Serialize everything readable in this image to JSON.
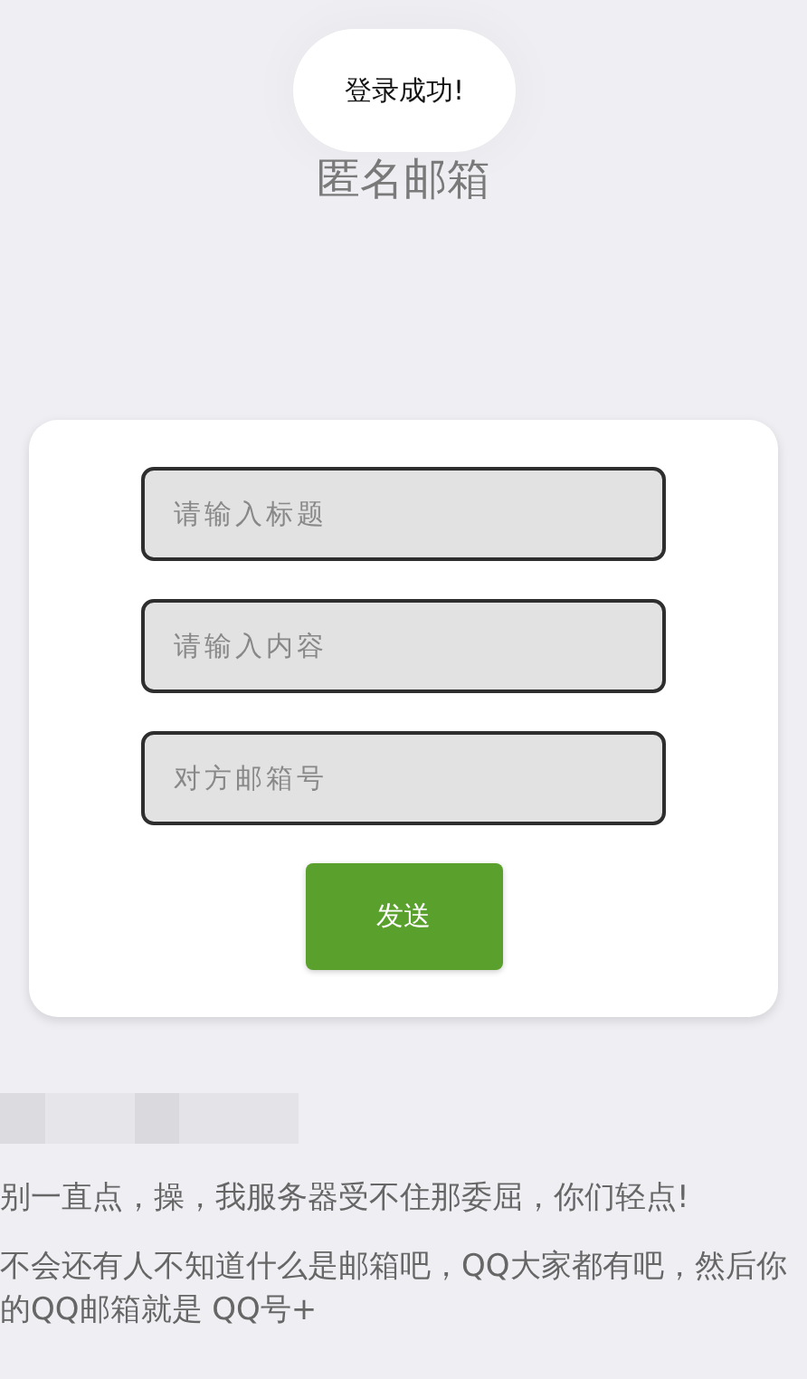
{
  "toast": {
    "message": "登录成功!"
  },
  "title": "匿名邮箱",
  "form": {
    "fields": [
      {
        "placeholder": "请输入标题"
      },
      {
        "placeholder": "请输入内容"
      },
      {
        "placeholder": "对方邮箱号"
      }
    ],
    "submit": "发送"
  },
  "notes": [
    "别一直点，操，我服务器受不住那委屈，你们轻点!",
    "不会还有人不知道什么是邮箱吧，QQ大家都有吧，然后你的QQ邮箱就是 QQ号+"
  ]
}
